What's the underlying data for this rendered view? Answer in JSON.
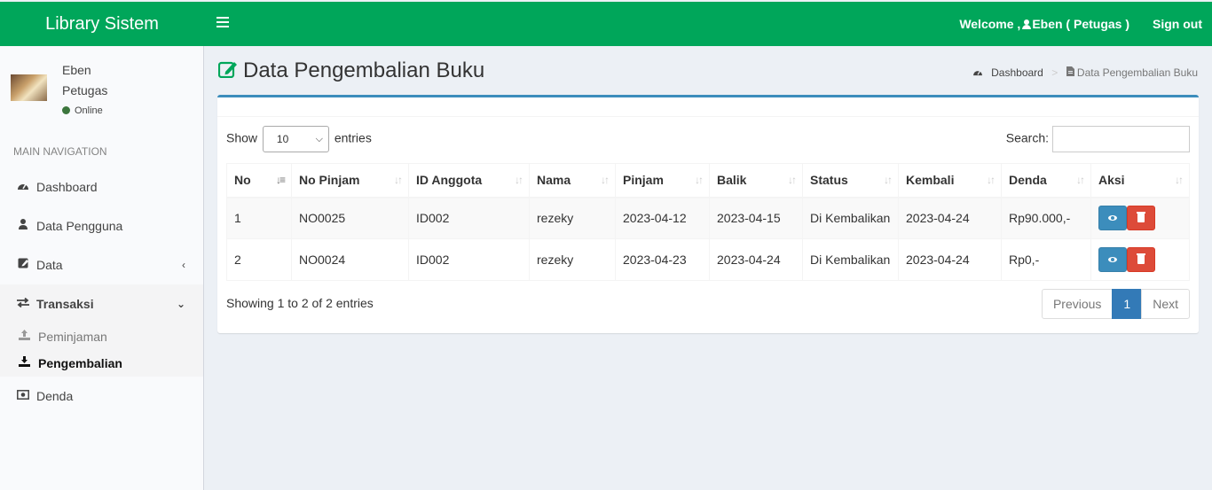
{
  "app": {
    "title": "Library Sistem"
  },
  "header": {
    "welcome_prefix": "Welcome ,",
    "welcome_user": "Eben ( Petugas )",
    "signout": "Sign out"
  },
  "user": {
    "name": "Eben",
    "role": "Petugas",
    "status": "Online"
  },
  "nav": {
    "header": "MAIN NAVIGATION",
    "items": [
      {
        "label": "Dashboard",
        "icon": "dashboard-icon"
      },
      {
        "label": "Data Pengguna",
        "icon": "user-icon"
      },
      {
        "label": "Data",
        "icon": "edit-icon"
      },
      {
        "label": "Transaksi",
        "icon": "exchange-icon"
      },
      {
        "label": "Denda",
        "icon": "money-icon"
      }
    ],
    "sub": [
      {
        "label": "Peminjaman",
        "icon": "upload-icon"
      },
      {
        "label": "Pengembalian",
        "icon": "download-icon"
      }
    ]
  },
  "page": {
    "title": "Data Pengembalian Buku"
  },
  "breadcrumb": {
    "home": "Dashboard",
    "current": "Data Pengembalian Buku"
  },
  "table": {
    "show_label": "Show",
    "entries_label": "entries",
    "page_size": "10",
    "search_label": "Search:",
    "columns": [
      "No",
      "No Pinjam",
      "ID Anggota",
      "Nama",
      "Pinjam",
      "Balik",
      "Status",
      "Kembali",
      "Denda",
      "Aksi"
    ],
    "rows": [
      [
        "1",
        "NO0025",
        "ID002",
        "rezeky",
        "2023-04-12",
        "2023-04-15",
        "Di Kembalikan",
        "2023-04-24",
        "Rp90.000,-"
      ],
      [
        "2",
        "NO0024",
        "ID002",
        "rezeky",
        "2023-04-23",
        "2023-04-24",
        "Di Kembalikan",
        "2023-04-24",
        "Rp0,-"
      ]
    ],
    "info": "Showing 1 to 2 of 2 entries",
    "pager": {
      "prev": "Previous",
      "current": "1",
      "next": "Next"
    }
  },
  "colors": {
    "header": "#00a65a",
    "box_border": "#3c8dbc",
    "view_button": "#3c8dbc",
    "delete_button": "#dd4b39",
    "page_active": "#337ab7"
  }
}
